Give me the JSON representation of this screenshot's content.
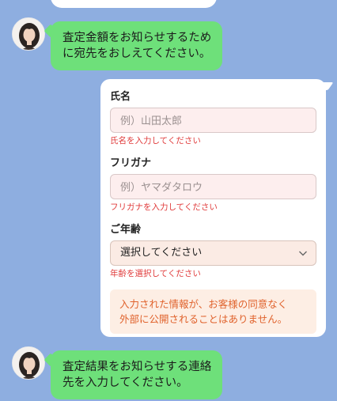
{
  "chat": {
    "message_1": "査定金額をお知らせするため\nに宛先をおしえてください。",
    "message_2": "査定結果をお知らせする連絡\n先を入力してください。"
  },
  "form": {
    "name": {
      "label": "氏名",
      "placeholder": "例）山田太郎",
      "error": "氏名を入力してください"
    },
    "kana": {
      "label": "フリガナ",
      "placeholder": "例）ヤマダタロウ",
      "error": "フリガナを入力してください"
    },
    "age": {
      "label": "ご年齢",
      "selected": "選択してください",
      "error": "年齢を選択してください"
    },
    "notice": "入力された情報が、お客様の同意なく\n外部に公開されることはありません。"
  },
  "colors": {
    "background": "#8eaee0",
    "bubble": "#6ee07a",
    "error": "#e03b3b",
    "notice_text": "#e0622c"
  },
  "icons": {
    "avatar": "operator-avatar-icon",
    "select": "chevron-down-icon"
  }
}
